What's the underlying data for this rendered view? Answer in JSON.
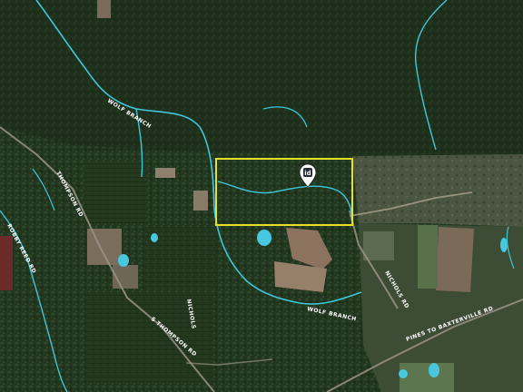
{
  "colors": {
    "forest_dark": "#1d2f1c",
    "forest_mid": "#2c4428",
    "field": "#7a6a58",
    "water": "#3fc6da",
    "boundary": "#e6e027",
    "pond": "#47c7e0"
  },
  "labels": {
    "wolf_branch_north": "WOLF BRANCH",
    "wolf_branch_south": "WOLF BRANCH",
    "thompson_rd_west": "THOMPSON RD",
    "road_south_west": "S THOMPSON RD",
    "road_south": "NICHOLS",
    "robbs_rd": "ROBBY REED RD",
    "road_east": "NICHOLS RD",
    "pines_rd": "PINES TO BAXTERVILLE RD"
  },
  "marker": {
    "icon": "id-pin-icon",
    "text": "id"
  }
}
